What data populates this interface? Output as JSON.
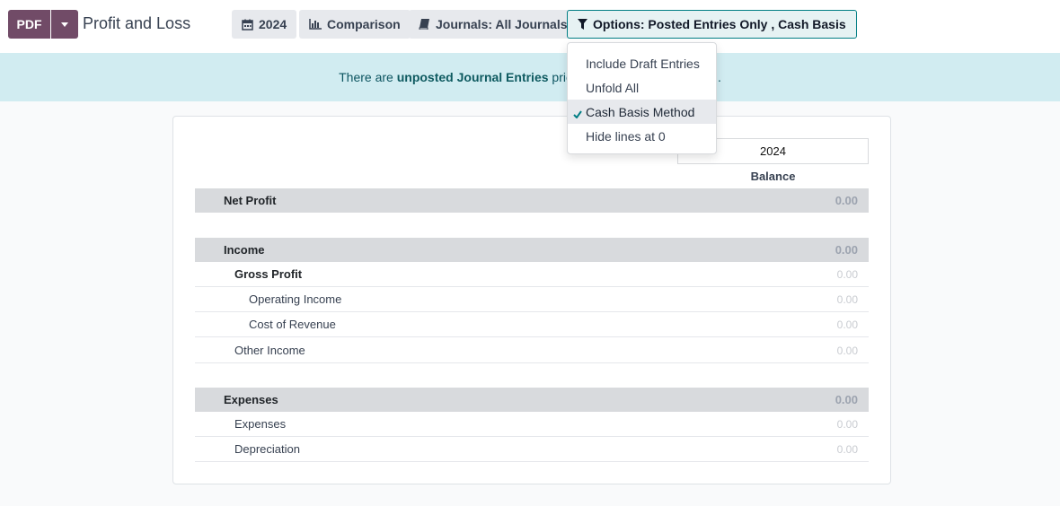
{
  "toolbar": {
    "pdf_label": "PDF",
    "title": "Profit and Loss",
    "filters": [
      {
        "label": "2024",
        "icon": "calendar-icon"
      },
      {
        "label": "Comparison",
        "icon": "bar-chart-icon"
      },
      {
        "label": "Journals: All Journals",
        "icon": "book-icon"
      },
      {
        "label": "Options: Posted Entries Only , Cash Basis",
        "icon": "filter-icon"
      }
    ]
  },
  "banner": {
    "prefix": "There are",
    "link": "unposted Journal Entries",
    "suffix_visible": "pric",
    "tail": "."
  },
  "options_menu": {
    "items": [
      {
        "label": "Include Draft Entries",
        "checked": false
      },
      {
        "label": "Unfold All",
        "checked": false
      },
      {
        "label": "Cash Basis Method",
        "checked": true
      },
      {
        "label": "Hide lines at 0",
        "checked": false
      }
    ]
  },
  "report": {
    "column_header": "2024",
    "column_subheader": "Balance",
    "rows": [
      {
        "label": "Net Profit",
        "amount": "0.00",
        "type": "section"
      },
      {
        "label": "Income",
        "amount": "0.00",
        "type": "section"
      },
      {
        "label": "Gross Profit",
        "amount": "0.00",
        "type": "subtotal"
      },
      {
        "label": "Operating Income",
        "amount": "0.00",
        "type": "line"
      },
      {
        "label": "Cost of Revenue",
        "amount": "0.00",
        "type": "line"
      },
      {
        "label": "Other Income",
        "amount": "0.00",
        "type": "line"
      },
      {
        "label": "Expenses",
        "amount": "0.00",
        "type": "section"
      },
      {
        "label": "Expenses",
        "amount": "0.00",
        "type": "line"
      },
      {
        "label": "Depreciation",
        "amount": "0.00",
        "type": "line"
      }
    ]
  },
  "colors": {
    "brand": "#714b67",
    "accent": "#017e84",
    "banner_bg": "#d1ecf1",
    "section_bg": "#d8dadd"
  }
}
